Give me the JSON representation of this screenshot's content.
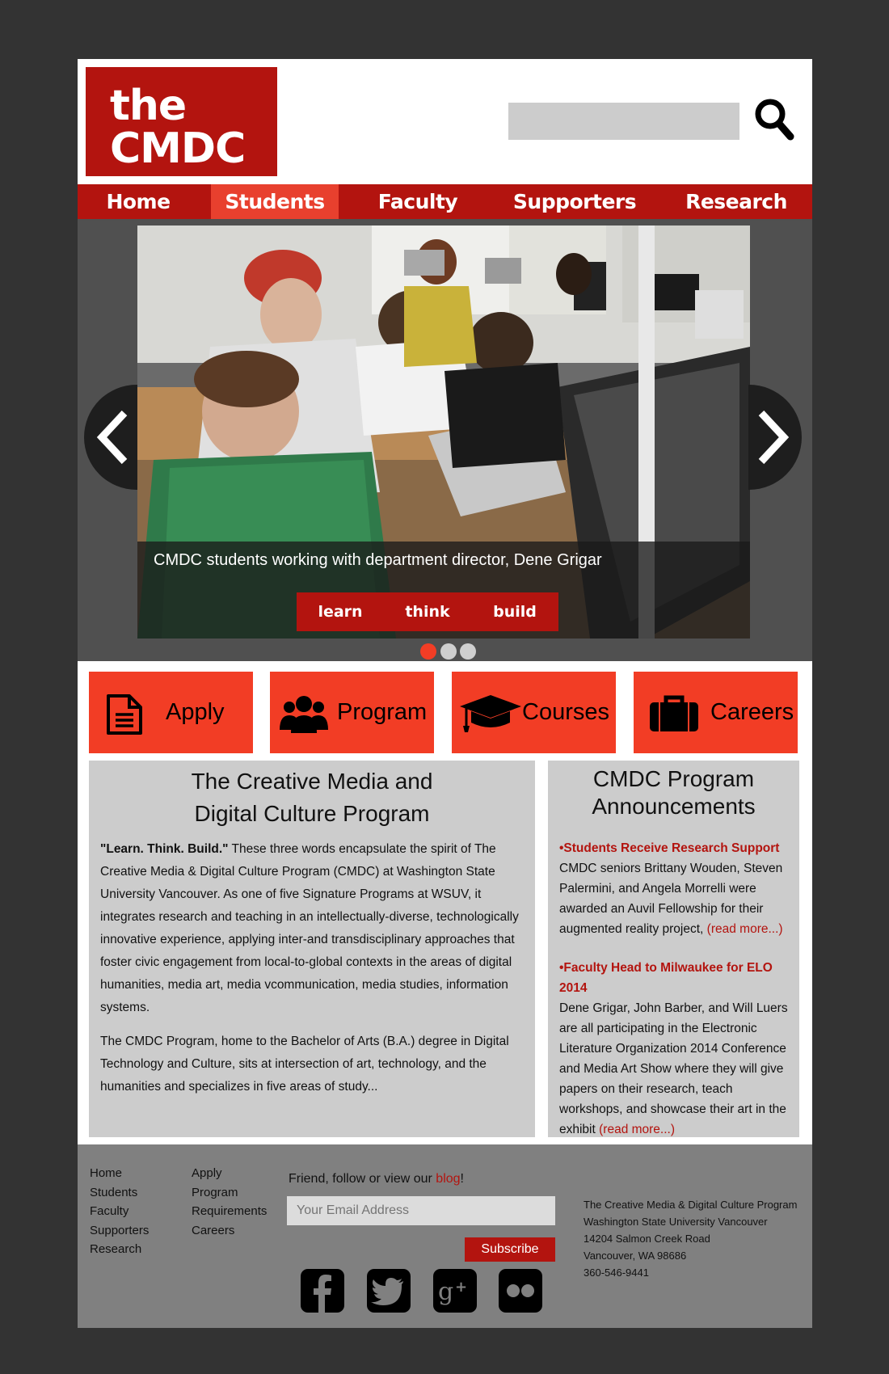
{
  "header": {
    "logo_line1": "the",
    "logo_line2": "CMDC",
    "search_placeholder": ""
  },
  "nav": {
    "items": [
      {
        "label": "Home"
      },
      {
        "label": "Students"
      },
      {
        "label": "Faculty"
      },
      {
        "label": "Supporters"
      },
      {
        "label": "Research"
      }
    ],
    "active_index": 1
  },
  "slider": {
    "caption": "CMDC students working with department director, Dene Grigar",
    "buttons": [
      {
        "label": "learn"
      },
      {
        "label": "think"
      },
      {
        "label": "build"
      }
    ],
    "dots": 3,
    "active_dot": 0
  },
  "tiles": [
    {
      "label": "Apply",
      "icon": "document-icon"
    },
    {
      "label": "Program",
      "icon": "people-icon"
    },
    {
      "label": "Courses",
      "icon": "graduation-cap-icon"
    },
    {
      "label": "Careers",
      "icon": "briefcase-icon"
    }
  ],
  "about": {
    "title_line1": "The Creative Media and",
    "title_line2": "Digital Culture Program",
    "para1_bold": "\"Learn. Think. Build.\"",
    "para1_rest": " These three words encapsulate the spirit of The Creative Media & Digital Culture Program (CMDC) at Washington State University Vancouver. As one of five Signature Programs at WSUV, it integrates research and teaching in an intellectually-diverse, technologically innovative experience, applying inter-and transdisciplinary approaches that foster civic engagement from local-to-global contexts in the areas of digital humanities, media art, media  vcommunication, media studies, information systems.",
    "para2": "The CMDC Program, home to the Bachelor of Arts (B.A.) degree in Digital Technology and Culture, sits at intersection of art, technology, and the humanities and specializes in five areas of study..."
  },
  "announcements": {
    "title_line1": "CMDC Program",
    "title_line2": "Announcements",
    "items": [
      {
        "title": "•Students Receive Research Support",
        "body": "CMDC seniors Brittany Wouden, Steven Palermini, and Angela Morrelli were awarded an Auvil Fellowship for their augmented reality project,",
        "more": "(read more...)"
      },
      {
        "title": "•Faculty Head to Milwaukee for ELO 2014",
        "body": "Dene Grigar, John Barber, and Will Luers are all participating in the Electronic Literature Organization 2014 Conference and Media Art Show where they will give papers on their research, teach workshops, and showcase their art in the exhibit",
        "more": "(read more...)"
      }
    ]
  },
  "footer": {
    "col1": [
      "Home",
      "Students",
      "Faculty",
      "Supporters",
      "Research"
    ],
    "col2": [
      "Apply",
      "Program",
      "Requirements",
      "Careers"
    ],
    "follow_text": "Friend, follow or view our ",
    "blog_link": "blog",
    "follow_end": "!",
    "email_placeholder": "Your Email Address",
    "subscribe_label": "Subscribe",
    "social": [
      "facebook-icon",
      "twitter-icon",
      "google-plus-icon",
      "flickr-icon"
    ],
    "address": [
      "The Creative Media & Digital Culture Program",
      "Washington State University Vancouver",
      "14204 Salmon Creek Road",
      "Vancouver, WA 98686",
      "360-546-9441"
    ]
  },
  "colors": {
    "brand_red": "#b3140f",
    "accent_orange": "#f23d25",
    "active_nav": "#e8402e",
    "panel_gray": "#cccccc",
    "footer_gray": "#808080",
    "background": "#333333"
  }
}
